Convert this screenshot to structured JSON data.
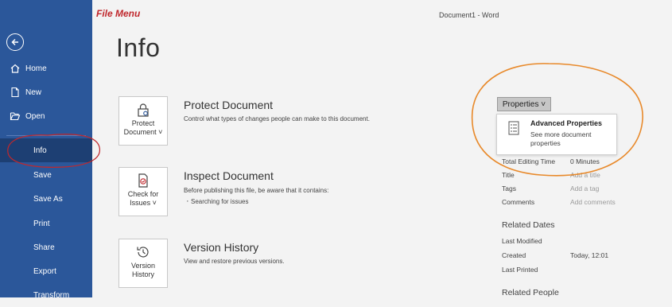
{
  "annotation": {
    "label": "File Menu"
  },
  "window": {
    "title": "Document1  -  Word"
  },
  "sidebar": {
    "back_icon": "back-arrow-icon",
    "items": [
      {
        "label": "Home",
        "icon": "home-icon"
      },
      {
        "label": "New",
        "icon": "new-document-icon"
      },
      {
        "label": "Open",
        "icon": "folder-open-icon"
      },
      {
        "label": "Info",
        "active": true
      },
      {
        "label": "Save"
      },
      {
        "label": "Save As"
      },
      {
        "label": "Print"
      },
      {
        "label": "Share"
      },
      {
        "label": "Export"
      },
      {
        "label": "Transform"
      }
    ]
  },
  "main": {
    "title": "Info",
    "sections": [
      {
        "tile_label_1": "Protect",
        "tile_label_2": "Document ˅",
        "icon": "lock-document-icon",
        "title": "Protect Document",
        "description": "Control what types of changes people can make to this document."
      },
      {
        "tile_label_1": "Check for",
        "tile_label_2": "Issues ˅",
        "icon": "check-document-icon",
        "title": "Inspect Document",
        "description": "Before publishing this file, be aware that it contains:",
        "bullet": "Searching for issues"
      },
      {
        "tile_label_1": "Version",
        "tile_label_2": "History",
        "icon": "history-clock-icon",
        "title": "Version History",
        "description": "View and restore previous versions."
      }
    ]
  },
  "properties": {
    "button_label": "Properties ˅",
    "dropdown": {
      "icon": "properties-list-icon",
      "title": "Advanced Properties",
      "description": "See more document properties"
    },
    "rows": [
      {
        "label": "Total Editing Time",
        "value": "0 Minutes",
        "placeholder": false
      },
      {
        "label": "Title",
        "value": "Add a title",
        "placeholder": true
      },
      {
        "label": "Tags",
        "value": "Add a tag",
        "placeholder": true
      },
      {
        "label": "Comments",
        "value": "Add comments",
        "placeholder": true
      }
    ],
    "related_dates": {
      "heading": "Related Dates",
      "rows": [
        {
          "label": "Last Modified",
          "value": ""
        },
        {
          "label": "Created",
          "value": "Today, 12:01"
        },
        {
          "label": "Last Printed",
          "value": ""
        }
      ]
    },
    "related_people": {
      "heading": "Related People"
    }
  },
  "colors": {
    "sidebar": "#2b579a",
    "sidebar_active": "#1d3f73",
    "annotation_red": "#c0282d",
    "annotation_orange": "#e8892a"
  }
}
